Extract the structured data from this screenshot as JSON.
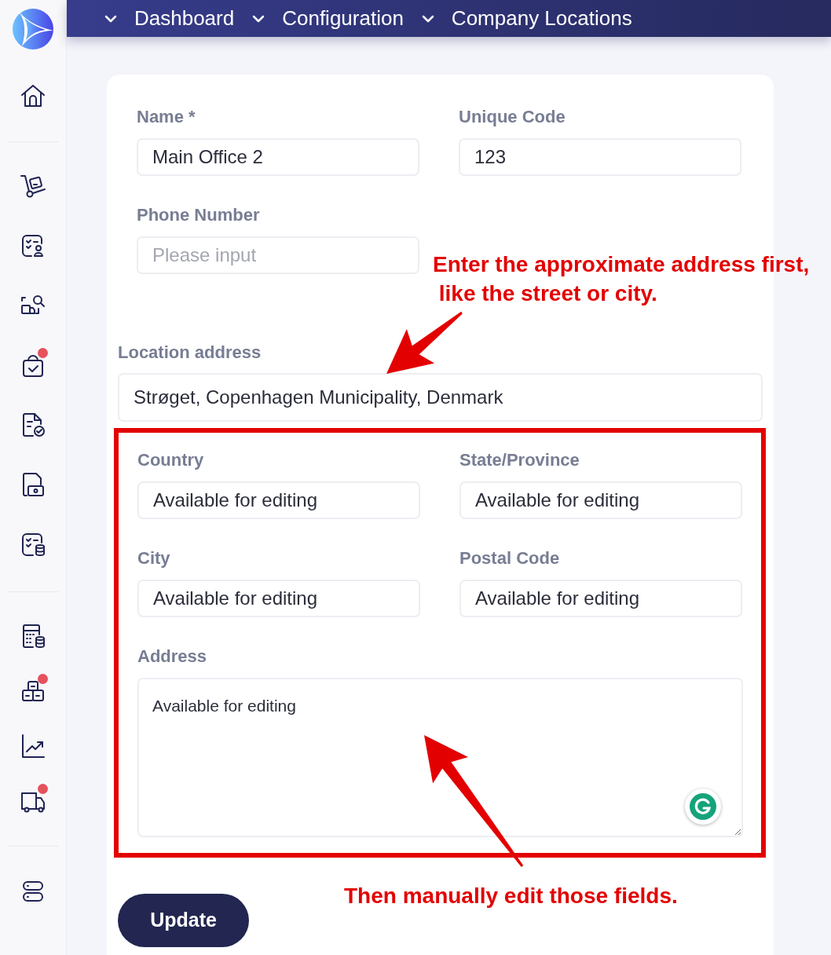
{
  "breadcrumbs": [
    {
      "label": "Dashboard"
    },
    {
      "label": "Configuration"
    },
    {
      "label": "Company Locations"
    }
  ],
  "sidebar": {
    "groups": [
      {
        "items": [
          {
            "badge": false
          }
        ]
      },
      {
        "items": [
          {
            "badge": false
          }
        ]
      },
      {
        "items": [
          {
            "badge": false
          },
          {
            "badge": false
          },
          {
            "badge": false
          },
          {
            "badge": true
          },
          {
            "badge": false
          },
          {
            "badge": false
          },
          {
            "badge": false
          }
        ]
      },
      {
        "items": [
          {
            "badge": false
          },
          {
            "badge": true
          },
          {
            "badge": false
          },
          {
            "badge": true
          }
        ]
      },
      {
        "items": [
          {
            "badge": false
          }
        ]
      }
    ]
  },
  "form": {
    "top_fields": [
      {
        "label": "Name *",
        "value": "Main Office 2"
      },
      {
        "label": "Unique Code",
        "value": "123"
      },
      {
        "label": "Phone Number",
        "placeholder": "Please input"
      }
    ],
    "location_address": {
      "label": "Location address",
      "value": "Strøget, Copenhagen Municipality, Denmark"
    },
    "detail_fields": [
      {
        "label": "Country",
        "value": "Available for editing",
        "kind": "input"
      },
      {
        "label": "State/Province",
        "value": "Available for editing",
        "kind": "input"
      },
      {
        "label": "City",
        "value": "Available for editing",
        "kind": "input"
      },
      {
        "label": "Postal Code",
        "value": "Available for editing",
        "kind": "input"
      },
      {
        "label": "Address",
        "value": "Available for editing",
        "kind": "textarea"
      }
    ],
    "submit": {
      "label": "Update"
    }
  },
  "annotations": [
    {
      "text": "Enter the approximate address first,\n like the street or city."
    },
    {
      "text": "Then manually edit those fields."
    }
  ]
}
